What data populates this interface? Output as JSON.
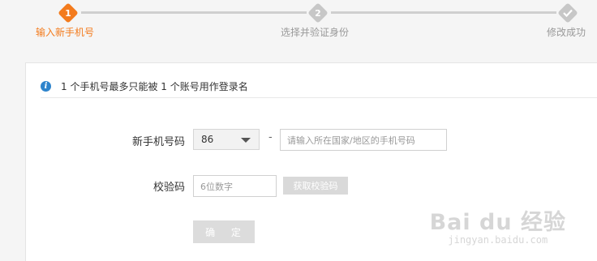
{
  "stepper": {
    "steps": [
      {
        "number": "1",
        "label": "输入新手机号",
        "state": "active"
      },
      {
        "number": "2",
        "label": "选择并验证身份",
        "state": "pending"
      },
      {
        "number": "",
        "label": "修改成功",
        "state": "pending"
      }
    ],
    "colors": {
      "active": "#f37b1d",
      "pending": "#c7c7c7"
    }
  },
  "notice": {
    "icon": "info-icon",
    "text": "1 个手机号最多只能被 1 个账号用作登录名"
  },
  "form": {
    "phone_label": "新手机号码",
    "country_code_value": "86",
    "separator": "-",
    "phone_placeholder": "请输入所在国家/地区的手机号码",
    "code_label": "校验码",
    "code_placeholder": "6位数字",
    "get_code_button": "获取校验码",
    "confirm_button": "确 定"
  },
  "watermark": {
    "main": "Bai du 经验",
    "sub": "jingyan.baidu.com"
  }
}
